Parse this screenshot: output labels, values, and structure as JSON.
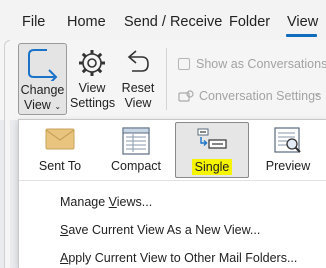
{
  "menubar": {
    "items": [
      {
        "label": "File",
        "name": "menu-file"
      },
      {
        "label": "Home",
        "name": "menu-home"
      },
      {
        "label": "Send / Receive",
        "name": "menu-send-receive"
      },
      {
        "label": "Folder",
        "name": "menu-folder"
      },
      {
        "label": "View",
        "name": "menu-view",
        "active": true
      }
    ]
  },
  "ribbon": {
    "change_view": {
      "line1": "Change",
      "line2": "View",
      "icon": "change-view-arrow-icon"
    },
    "view_settings": {
      "line1": "View",
      "line2": "Settings",
      "icon": "gear-icon"
    },
    "reset_view": {
      "line1": "Reset",
      "line2": "View",
      "icon": "reset-arrow-icon"
    },
    "show_as_conversations": {
      "label": "Show as Conversations",
      "checked": false,
      "enabled": false
    },
    "conversation_settings": {
      "label": "Conversation Settings",
      "enabled": false
    }
  },
  "dropdown": {
    "gallery": [
      {
        "label": "Sent To",
        "icon": "envelope-icon",
        "selected": false
      },
      {
        "label": "Compact",
        "icon": "compact-list-icon",
        "selected": false
      },
      {
        "label": "Single",
        "icon": "single-view-icon",
        "selected": true,
        "highlight": "#f5f502"
      },
      {
        "label": "Preview",
        "icon": "preview-icon",
        "selected": false
      }
    ],
    "commands": [
      {
        "label": "Manage Views...",
        "mnemonic": "V"
      },
      {
        "label": "Save Current View As a New View...",
        "mnemonic": "S"
      },
      {
        "label": "Apply Current View to Other Mail Folders...",
        "mnemonic": "A"
      }
    ]
  },
  "colors": {
    "accent": "#0f6cbd",
    "highlight": "#f5f502"
  }
}
